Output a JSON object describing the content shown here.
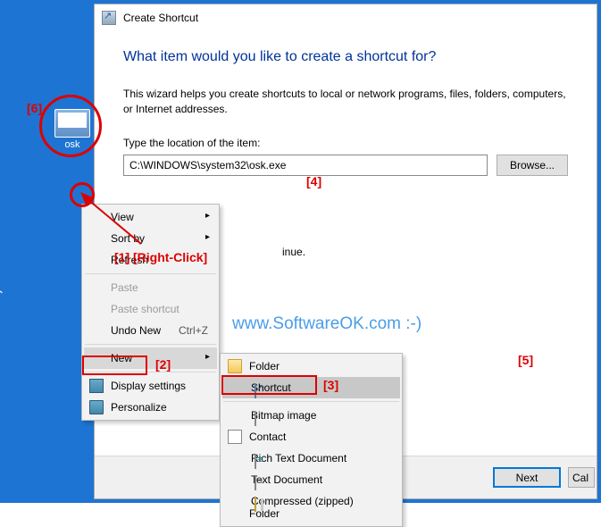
{
  "dialog": {
    "title": "Create Shortcut",
    "heading": "What item would you like to create a shortcut for?",
    "description": "This wizard helps you create shortcuts to local or network programs, files, folders, computers, or Internet addresses.",
    "location_label": "Type the location of the item:",
    "location_value": "C:\\WINDOWS\\system32\\osk.exe",
    "browse_label": "Browse...",
    "continue_text": "inue.",
    "next_label": "Next",
    "cancel_label": "Cal"
  },
  "desktop_icon": {
    "label": "osk"
  },
  "context_menu": {
    "view": "View",
    "sort_by": "Sort by",
    "refresh": "Refresh",
    "paste": "Paste",
    "paste_shortcut": "Paste shortcut",
    "undo_new": "Undo New",
    "undo_shortcut": "Ctrl+Z",
    "new": "New",
    "display_settings": "Display settings",
    "personalize": "Personalize"
  },
  "submenu": {
    "folder": "Folder",
    "shortcut": "Shortcut",
    "bitmap": "Bitmap image",
    "contact": "Contact",
    "rtf": "Rich Text Document",
    "text": "Text Document",
    "compressed": "Compressed (zipped) Folder"
  },
  "annotations": {
    "a1": "[1] [Right-Click]",
    "a2": "[2]",
    "a3": "[3]",
    "a4": "[4]",
    "a5": "[5]",
    "a6": "[6]"
  },
  "watermark": "www.SoftwareOK.com :-)"
}
